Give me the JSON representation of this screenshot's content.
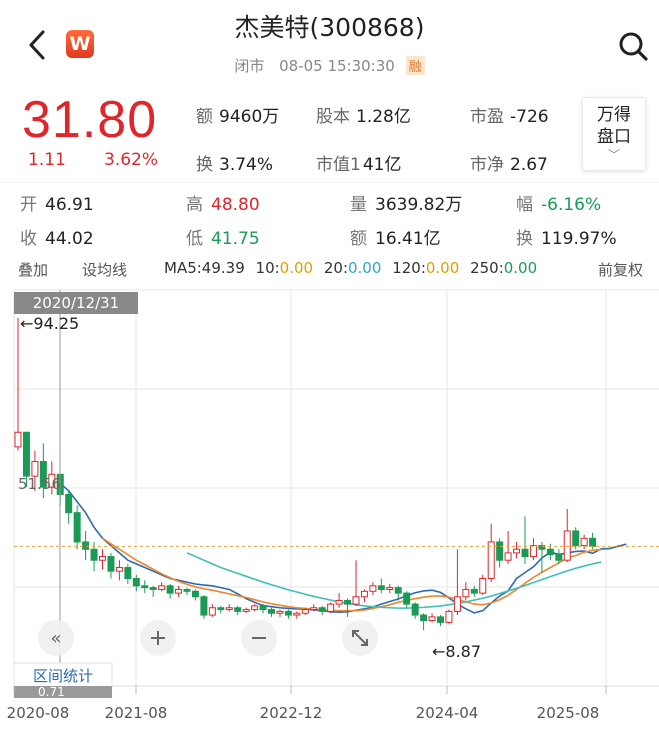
{
  "header": {
    "title": "杰美特(300868)",
    "status": "闭市",
    "datetime": "08-05 15:30:30",
    "badge": "融",
    "brand_badge": "W"
  },
  "quote": {
    "price": "31.80",
    "change": "1.11",
    "change_pct": "3.62%",
    "amount_label": "额",
    "amount": "9460万",
    "share_label": "股本",
    "share": "1.28亿",
    "pe_label": "市盈",
    "pe": "-726",
    "turnover_label": "换",
    "turnover": "3.74%",
    "mcap_label": "市值1",
    "mcap": "41亿",
    "pb_label": "市净",
    "pb": "2.67",
    "pankou_line1": "万得",
    "pankou_line2": "盘口"
  },
  "stats": {
    "open_label": "开",
    "open": "46.91",
    "high_label": "高",
    "high": "48.80",
    "vol_label": "量",
    "vol": "3639.82万",
    "range_label": "幅",
    "range": "-6.16%",
    "close_label": "收",
    "close": "44.02",
    "low_label": "低",
    "low": "41.75",
    "amt_label": "额",
    "amt": "16.41亿",
    "turn_label": "换",
    "turn": "119.97%"
  },
  "toolbar": {
    "overlay": "叠加",
    "draw": "设均线",
    "ma5": "MA5:49.39",
    "ma10_k": "10:",
    "ma10": "0.00",
    "ma20_k": "20:",
    "ma20": "0.00",
    "ma120_k": "120:",
    "ma120": "0.00",
    "ma250_k": "250:",
    "ma250": "0.00",
    "adjust": "前复权"
  },
  "chart_data": {
    "type": "candlestick",
    "period": "monthly",
    "y_range": [
      0.71,
      94.25
    ],
    "x_tick_labels": [
      "2020-08",
      "2021-08",
      "2022-12",
      "2024-04",
      "2025-08"
    ],
    "crosshair_date": "2020/12/31",
    "crosshair_value": "51.56",
    "y_min_label": "0.71",
    "annotations": {
      "max": "←94.25",
      "min": "←8.87"
    },
    "last_price_line": 31.8,
    "candles": [
      [
        59.0,
        63.0,
        94.25,
        58.0
      ],
      [
        63.0,
        51.0,
        62.0,
        48.0
      ],
      [
        51.0,
        55.0,
        58.0,
        47.0
      ],
      [
        55.0,
        48.0,
        60.0,
        45.0
      ],
      [
        48.0,
        51.5,
        55.0,
        46.0
      ],
      [
        51.5,
        46.0,
        51.56,
        43.0
      ],
      [
        46.0,
        41.0,
        47.0,
        38.0
      ],
      [
        41.0,
        33.0,
        43.0,
        31.0
      ],
      [
        33.0,
        31.0,
        36.0,
        28.0
      ],
      [
        31.0,
        28.0,
        33.0,
        25.0
      ],
      [
        28.0,
        29.0,
        31.0,
        25.5
      ],
      [
        29.0,
        25.0,
        30.0,
        23.0
      ],
      [
        25.0,
        26.0,
        28.0,
        22.5
      ],
      [
        26.0,
        23.0,
        27.0,
        21.5
      ],
      [
        23.0,
        21.0,
        24.0,
        19.5
      ],
      [
        21.0,
        20.5,
        22.5,
        19.0
      ],
      [
        20.5,
        20.0,
        21.0,
        18.0
      ],
      [
        20.0,
        21.0,
        22.0,
        19.5
      ],
      [
        21.0,
        19.0,
        21.5,
        17.5
      ],
      [
        19.0,
        20.0,
        21.0,
        18.0
      ],
      [
        20.0,
        19.5,
        20.5,
        18.5
      ],
      [
        19.5,
        18.0,
        20.0,
        17.0
      ],
      [
        18.0,
        13.0,
        18.5,
        12.0
      ],
      [
        13.0,
        15.0,
        16.0,
        12.5
      ],
      [
        15.0,
        14.5,
        15.5,
        13.5
      ],
      [
        14.5,
        15.0,
        16.0,
        14.0
      ],
      [
        15.0,
        14.0,
        15.5,
        13.0
      ],
      [
        14.0,
        14.5,
        15.0,
        13.5
      ],
      [
        14.5,
        15.5,
        16.0,
        14.0
      ],
      [
        15.5,
        14.5,
        16.0,
        13.5
      ],
      [
        14.5,
        13.5,
        15.0,
        12.5
      ],
      [
        13.5,
        14.0,
        14.5,
        12.5
      ],
      [
        14.0,
        13.0,
        14.5,
        12.0
      ],
      [
        13.0,
        13.5,
        14.0,
        12.0
      ],
      [
        13.5,
        14.5,
        15.0,
        13.0
      ],
      [
        14.5,
        15.0,
        16.0,
        14.0
      ],
      [
        15.0,
        14.0,
        15.5,
        13.0
      ],
      [
        14.0,
        16.0,
        16.5,
        13.5
      ],
      [
        16.0,
        17.0,
        19.0,
        15.0
      ],
      [
        17.0,
        16.0,
        17.5,
        12.5
      ],
      [
        16.0,
        18.0,
        28.0,
        15.5
      ],
      [
        18.0,
        19.5,
        20.0,
        16.5
      ],
      [
        19.5,
        21.0,
        22.0,
        18.5
      ],
      [
        21.0,
        20.0,
        23.0,
        19.0
      ],
      [
        20.0,
        20.5,
        21.5,
        19.0
      ],
      [
        20.5,
        19.0,
        21.0,
        17.0
      ],
      [
        19.0,
        16.0,
        19.5,
        15.0
      ],
      [
        16.0,
        13.0,
        16.5,
        12.0
      ],
      [
        13.0,
        11.5,
        13.5,
        8.87
      ],
      [
        11.5,
        12.5,
        13.5,
        11.0
      ],
      [
        12.5,
        11.0,
        13.0,
        10.0
      ],
      [
        11.0,
        14.0,
        14.5,
        10.5
      ],
      [
        14.0,
        18.0,
        31.0,
        13.0
      ],
      [
        18.0,
        20.0,
        22.0,
        17.0
      ],
      [
        20.0,
        19.0,
        21.0,
        18.0
      ],
      [
        19.0,
        23.0,
        24.0,
        18.5
      ],
      [
        23.0,
        33.0,
        38.0,
        22.0
      ],
      [
        33.0,
        28.0,
        34.0,
        26.0
      ],
      [
        28.0,
        30.0,
        36.0,
        27.0
      ],
      [
        30.0,
        31.0,
        33.0,
        28.5
      ],
      [
        31.0,
        29.0,
        40.0,
        27.0
      ],
      [
        29.0,
        32.0,
        34.0,
        28.0
      ],
      [
        32.0,
        31.0,
        33.0,
        24.5
      ],
      [
        31.0,
        29.5,
        32.5,
        28.0
      ],
      [
        29.5,
        28.0,
        31.0,
        27.0
      ],
      [
        28.0,
        36.0,
        42.0,
        27.5
      ],
      [
        36.0,
        32.0,
        37.0,
        31.0
      ],
      [
        32.0,
        34.0,
        35.0,
        31.0
      ],
      [
        34.0,
        31.8,
        35.5,
        31.0
      ]
    ],
    "ma_lines": [
      {
        "color": "#2b6cb0",
        "start": 5,
        "values": [
          49,
          47,
          44,
          41,
          37,
          34,
          32,
          30,
          28,
          27,
          26,
          25,
          24,
          23,
          22.5,
          22,
          21.5,
          21.2,
          21,
          20.5,
          20,
          18.8,
          17.5,
          16.5,
          15.6,
          15.3,
          15,
          14.8,
          14.7,
          14.6,
          14.4,
          14.2,
          13.9,
          13.8,
          13.9,
          14.3,
          14.7,
          15.2,
          16.0,
          16.7,
          17.4,
          18.3,
          19.1,
          19.6,
          19.8,
          19.2,
          17.7,
          16.0,
          14.7,
          13.6,
          14.2,
          16.3,
          18.2,
          19.6,
          23.0,
          24.6,
          26.2,
          28.6,
          30.2,
          29.6,
          30.0,
          30.4,
          30.5,
          29.9,
          31.1,
          31.2,
          31.8,
          32.4
        ]
      },
      {
        "color": "#f0852d",
        "start": 10,
        "values": [
          34,
          32.5,
          31,
          29.5,
          28,
          26.8,
          25.5,
          24.3,
          23.2,
          22.2,
          21.4,
          20.7,
          20.2,
          19.8,
          19.3,
          18.8,
          18.3,
          17.8,
          17.2,
          16.6,
          16.1,
          15.7,
          15.3,
          15.0,
          14.8,
          14.6,
          14.4,
          14.3,
          14.2,
          14.2,
          14.2,
          14.4,
          14.8,
          15.3,
          15.8,
          16.5,
          17.0,
          17.5,
          17.9,
          18.2,
          18.2,
          17.9,
          17.3,
          16.6,
          16.0,
          15.8,
          16.3,
          17.2,
          18.4,
          20.0,
          21.7,
          23.3,
          24.7,
          26.0,
          27.3,
          28.6,
          29.3,
          30.2,
          30.7,
          30.9
        ]
      },
      {
        "color": "#3fbfb8",
        "start": 20,
        "values": [
          30,
          29,
          28,
          27,
          26,
          25.2,
          24.4,
          23.6,
          22.8,
          22.0,
          21.3,
          20.6,
          19.9,
          19.3,
          18.7,
          18.1,
          17.6,
          17.1,
          16.6,
          16.2,
          15.8,
          15.5,
          15.3,
          15.1,
          15.0,
          14.9,
          14.9,
          15.0,
          15.1,
          15.3,
          15.5,
          15.8,
          16.2,
          16.6,
          17.1,
          17.6,
          18.2,
          18.9,
          19.6,
          20.3,
          21.1,
          21.9,
          22.7,
          23.5,
          24.3,
          25.1,
          25.8,
          26.4,
          27.0,
          27.5
        ]
      }
    ]
  }
}
